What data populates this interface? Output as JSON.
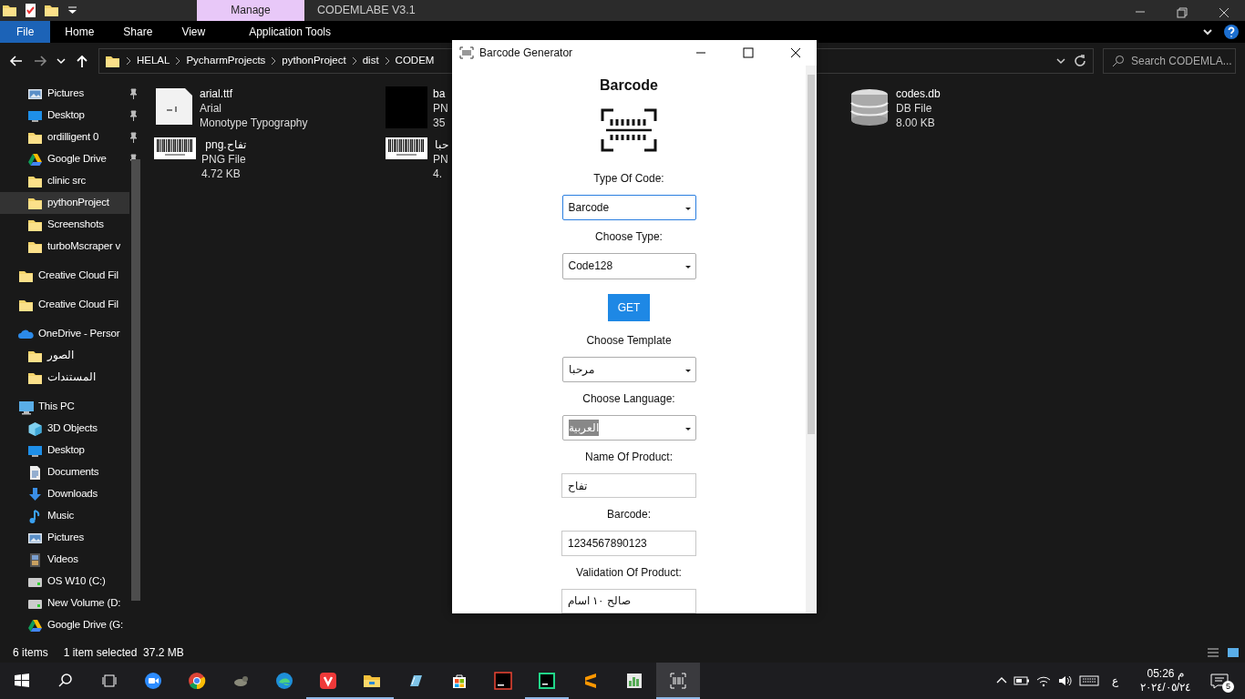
{
  "explorer": {
    "contextual_tab": "Manage",
    "title": "CODEMLABE V3.1",
    "ribbon_tabs": [
      {
        "label": "File",
        "selected": true
      },
      {
        "label": "Home",
        "selected": false
      },
      {
        "label": "Share",
        "selected": false
      },
      {
        "label": "View",
        "selected": false
      },
      {
        "label": "Application Tools",
        "selected": false
      }
    ],
    "breadcrumb": [
      "HELAL",
      "PycharmProjects",
      "pythonProject",
      "dist",
      "CODEM"
    ],
    "search": {
      "placeholder": "Search CODEMLA..."
    },
    "sidebar": [
      {
        "label": "Pictures",
        "kind": "pictures",
        "pinned": true,
        "selected": false
      },
      {
        "label": "Desktop",
        "kind": "desktop",
        "pinned": true,
        "selected": false
      },
      {
        "label": "ordilligent 0",
        "kind": "folder",
        "pinned": true,
        "selected": false
      },
      {
        "label": "Google Drive",
        "kind": "gdrive",
        "pinned": true,
        "selected": false
      },
      {
        "label": "clinic src",
        "kind": "folder",
        "pinned": false,
        "selected": false
      },
      {
        "label": "pythonProject",
        "kind": "folder",
        "pinned": false,
        "selected": true
      },
      {
        "label": "Screenshots",
        "kind": "folder",
        "pinned": false,
        "selected": false
      },
      {
        "label": "turboMscraper v",
        "kind": "folder",
        "pinned": false,
        "selected": false
      },
      {
        "label": "Creative Cloud Fil",
        "kind": "folder",
        "pinned": false,
        "selected": false,
        "top": true
      },
      {
        "label": "Creative Cloud Fil",
        "kind": "folder",
        "pinned": false,
        "selected": false,
        "top": true
      },
      {
        "label": "OneDrive - Persor",
        "kind": "onedrive",
        "pinned": false,
        "selected": false,
        "top": true,
        "children": [
          {
            "label": "الصور",
            "kind": "folder",
            "pinned": false,
            "selected": false
          },
          {
            "label": "المستندات",
            "kind": "folder",
            "pinned": false,
            "selected": false
          }
        ]
      },
      {
        "label": "This PC",
        "kind": "pc",
        "pinned": false,
        "selected": false,
        "top": true,
        "children": [
          {
            "label": "3D Objects",
            "kind": "cube",
            "pinned": false,
            "selected": false
          },
          {
            "label": "Desktop",
            "kind": "desktop",
            "pinned": false,
            "selected": false
          },
          {
            "label": "Documents",
            "kind": "docs",
            "pinned": false,
            "selected": false
          },
          {
            "label": "Downloads",
            "kind": "download",
            "pinned": false,
            "selected": false
          },
          {
            "label": "Music",
            "kind": "music",
            "pinned": false,
            "selected": false
          },
          {
            "label": "Pictures",
            "kind": "pictures",
            "pinned": false,
            "selected": false
          },
          {
            "label": "Videos",
            "kind": "videos",
            "pinned": false,
            "selected": false
          },
          {
            "label": "OS W10 (C:)",
            "kind": "drive",
            "pinned": false,
            "selected": false
          },
          {
            "label": "New Volume (D:",
            "kind": "drive",
            "pinned": false,
            "selected": false
          },
          {
            "label": "Google Drive (G:",
            "kind": "gdrive",
            "pinned": false,
            "selected": false
          }
        ]
      }
    ],
    "files": [
      {
        "kind": "font",
        "lines": [
          "arial.ttf",
          "Arial",
          "Monotype Typography"
        ]
      },
      {
        "kind": "black",
        "lines": [
          "ba",
          "PN",
          "35"
        ]
      },
      {
        "kind": "db",
        "lines": [
          "codes.db",
          "DB File",
          "8.00 KB"
        ]
      },
      {
        "kind": "barcode",
        "lines": [
          "تفاح.png",
          "PNG File",
          "4.72 KB"
        ]
      },
      {
        "kind": "barcode",
        "lines": [
          "حبا",
          "PN",
          "4."
        ]
      }
    ],
    "status_bar": [
      "6 items",
      "1 item selected  37.2 MB"
    ]
  },
  "dialog": {
    "title": "Barcode Generator",
    "heading": "Barcode",
    "form": [
      {
        "kind": "label",
        "text": "Type Of Code:"
      },
      {
        "kind": "select",
        "value": "Barcode",
        "focused": true
      },
      {
        "kind": "label",
        "text": "Choose Type:"
      },
      {
        "kind": "select",
        "value": "Code128",
        "focused": false
      },
      {
        "kind": "button",
        "text": "GET"
      },
      {
        "kind": "label",
        "text": "Choose Template"
      },
      {
        "kind": "select",
        "value": "مرحبا",
        "focused": false
      },
      {
        "kind": "label",
        "text": "Choose Language:"
      },
      {
        "kind": "select",
        "value": "العربية",
        "focused": false,
        "highlighted": true
      },
      {
        "kind": "label",
        "text": "Name Of Product:"
      },
      {
        "kind": "input",
        "value": "تفاح"
      },
      {
        "kind": "label",
        "text": "Barcode:"
      },
      {
        "kind": "input",
        "value": "1234567890123"
      },
      {
        "kind": "label",
        "text": "Validation Of Product:"
      },
      {
        "kind": "input",
        "value": "صالح ١٠ اسام"
      }
    ]
  },
  "taskbar": {
    "apps": [
      {
        "kind": "windows",
        "running": false,
        "selected": false
      },
      {
        "kind": "search",
        "running": false,
        "selected": false
      },
      {
        "kind": "taskview",
        "running": false,
        "selected": false
      },
      {
        "kind": "zoom",
        "running": false,
        "selected": false
      },
      {
        "kind": "chrome",
        "running": false,
        "selected": false
      },
      {
        "kind": "gimp",
        "running": false,
        "selected": false
      },
      {
        "kind": "edge",
        "running": false,
        "selected": false
      },
      {
        "kind": "vivaldi",
        "running": true,
        "selected": false
      },
      {
        "kind": "explorer",
        "running": true,
        "selected": false
      },
      {
        "kind": "notepad",
        "running": false,
        "selected": false
      },
      {
        "kind": "store",
        "running": false,
        "selected": false
      },
      {
        "kind": "intellij",
        "running": false,
        "selected": false
      },
      {
        "kind": "pycharm",
        "running": true,
        "selected": false
      },
      {
        "kind": "sublime",
        "running": false,
        "selected": false
      },
      {
        "kind": "chart",
        "running": false,
        "selected": false
      },
      {
        "kind": "barcode",
        "running": true,
        "selected": true
      }
    ],
    "language": "ع",
    "time": "05:26 م",
    "date": "٢٠٢٤/٠٥/٢٤",
    "notifications": "5"
  }
}
